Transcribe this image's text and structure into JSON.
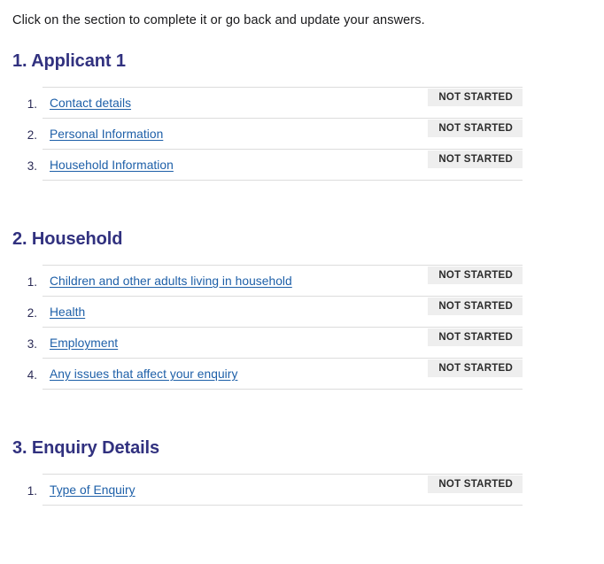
{
  "intro": "Click on the section to complete it or go back and update your answers.",
  "status_label": "NOT STARTED",
  "colors": {
    "heading": "#31317f",
    "link": "#1d5fa8",
    "status_bg": "#eeeeee",
    "status_text": "#2b2b2b",
    "divider": "#dcdcdc",
    "body_text": "#18181a"
  },
  "sections": [
    {
      "heading": "1. Applicant 1",
      "tasks": [
        {
          "number": "1.",
          "label": "Contact details",
          "status": "NOT STARTED"
        },
        {
          "number": "2.",
          "label": "Personal Information",
          "status": "NOT STARTED"
        },
        {
          "number": "3.",
          "label": "Household Information",
          "status": "NOT STARTED"
        }
      ]
    },
    {
      "heading": "2. Household",
      "tasks": [
        {
          "number": "1.",
          "label": "Children and other adults living in household",
          "status": "NOT STARTED"
        },
        {
          "number": "2.",
          "label": "Health",
          "status": "NOT STARTED"
        },
        {
          "number": "3.",
          "label": "Employment",
          "status": "NOT STARTED"
        },
        {
          "number": "4.",
          "label": "Any issues that affect your enquiry",
          "status": "NOT STARTED"
        }
      ]
    },
    {
      "heading": "3. Enquiry Details",
      "tasks": [
        {
          "number": "1.",
          "label": "Type of Enquiry",
          "status": "NOT STARTED"
        }
      ]
    }
  ]
}
